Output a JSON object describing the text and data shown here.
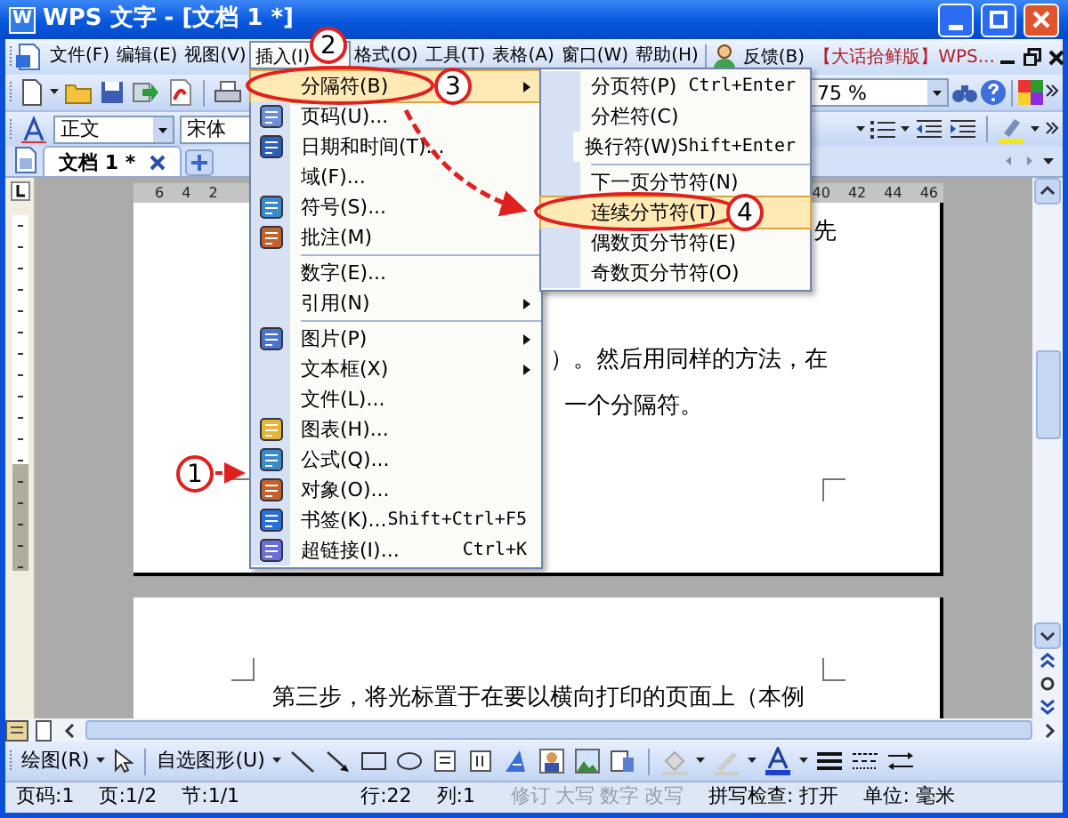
{
  "window": {
    "title": "WPS 文字 - [文档 1 *]",
    "icon_letter": "W"
  },
  "menu_bar": {
    "items": [
      {
        "label": "文件(F)",
        "selected": false
      },
      {
        "label": "编辑(E)",
        "selected": false
      },
      {
        "label": "视图(V)",
        "selected": false
      },
      {
        "label": "插入(I)",
        "selected": true
      },
      {
        "label": "格式(O)",
        "selected": false
      },
      {
        "label": "工具(T)",
        "selected": false
      },
      {
        "label": "表格(A)",
        "selected": false
      },
      {
        "label": "窗口(W)",
        "selected": false
      },
      {
        "label": "帮助(H)",
        "selected": false
      }
    ],
    "feedback": "反馈(B)",
    "edition": "【大话拾鲜版】WPS..."
  },
  "toolbar": {
    "zoom": "75 %"
  },
  "format_bar": {
    "style": "正文",
    "font": "宋体"
  },
  "doc_tabs": [
    {
      "label": "文档 1 *",
      "selected": true
    }
  ],
  "ruler": {
    "left_labels": [
      "6",
      "4",
      "2"
    ],
    "right_labels": [
      "40",
      "42",
      "44",
      "46"
    ]
  },
  "page1": {
    "lines": [
      "先",
      "）。然后用同样的方法，在",
      "一个分隔符。"
    ]
  },
  "page2": {
    "lines": [
      "第三步，将光标置于在要以横向打印的页面上（本例"
    ]
  },
  "insert_menu": {
    "items": [
      {
        "kind": "item",
        "label": "分隔符(B)",
        "icon": false,
        "submenu": true,
        "selected": true
      },
      {
        "kind": "item",
        "label": "页码(U)...",
        "icon": true,
        "submenu": false,
        "selected": false
      },
      {
        "kind": "item",
        "label": "日期和时间(T)...",
        "icon": true,
        "submenu": false,
        "selected": false
      },
      {
        "kind": "item",
        "label": "域(F)...",
        "icon": false,
        "submenu": false,
        "selected": false
      },
      {
        "kind": "item",
        "label": "符号(S)...",
        "icon": true,
        "submenu": false,
        "selected": false
      },
      {
        "kind": "item",
        "label": "批注(M)",
        "icon": true,
        "submenu": false,
        "selected": false
      },
      {
        "kind": "separator"
      },
      {
        "kind": "item",
        "label": "数字(E)...",
        "icon": false,
        "submenu": false,
        "selected": false
      },
      {
        "kind": "item",
        "label": "引用(N)",
        "icon": false,
        "submenu": true,
        "selected": false
      },
      {
        "kind": "separator"
      },
      {
        "kind": "item",
        "label": "图片(P)",
        "icon": true,
        "submenu": true,
        "selected": false
      },
      {
        "kind": "item",
        "label": "文本框(X)",
        "icon": false,
        "submenu": true,
        "selected": false
      },
      {
        "kind": "item",
        "label": "文件(L)...",
        "icon": false,
        "submenu": false,
        "selected": false
      },
      {
        "kind": "item",
        "label": "图表(H)...",
        "icon": true,
        "submenu": false,
        "selected": false
      },
      {
        "kind": "item",
        "label": "公式(Q)...",
        "icon": true,
        "submenu": false,
        "selected": false
      },
      {
        "kind": "item",
        "label": "对象(O)...",
        "icon": true,
        "submenu": false,
        "selected": false
      },
      {
        "kind": "item",
        "label": "书签(K)...",
        "icon": true,
        "submenu": false,
        "selected": false,
        "shortcut": "Shift+Ctrl+F5"
      },
      {
        "kind": "item",
        "label": "超链接(I)...",
        "icon": true,
        "submenu": false,
        "selected": false,
        "shortcut": "Ctrl+K"
      }
    ]
  },
  "break_submenu": {
    "items": [
      {
        "kind": "item",
        "label": "分页符(P)",
        "selected": false,
        "shortcut": "Ctrl+Enter"
      },
      {
        "kind": "item",
        "label": "分栏符(C)",
        "selected": false
      },
      {
        "kind": "item",
        "label": "换行符(W)",
        "selected": false,
        "shortcut": "Shift+Enter"
      },
      {
        "kind": "separator"
      },
      {
        "kind": "item",
        "label": "下一页分节符(N)",
        "selected": false
      },
      {
        "kind": "item",
        "label": "连续分节符(T)",
        "selected": true
      },
      {
        "kind": "item",
        "label": "偶数页分节符(E)",
        "selected": false
      },
      {
        "kind": "item",
        "label": "奇数页分节符(O)",
        "selected": false
      }
    ]
  },
  "drawing_toolbar": {
    "draw": "绘图(R)",
    "autoshapes": "自选图形(U)"
  },
  "status_bar": {
    "page_info": [
      "页码:1",
      "页:1/2",
      "节:1/1"
    ],
    "cursor_info": [
      "行:22",
      "列:1"
    ],
    "modes": [
      {
        "text": "修订",
        "disabled": true
      },
      {
        "text": "大写",
        "disabled": true
      },
      {
        "text": "数字",
        "disabled": true
      },
      {
        "text": "改写",
        "disabled": true
      }
    ],
    "spell_check": "拼写检查: 打开",
    "unit": "单位: 毫米"
  },
  "annotations": [
    {
      "label": "1"
    },
    {
      "label": "2"
    },
    {
      "label": "3"
    },
    {
      "label": "4"
    }
  ]
}
